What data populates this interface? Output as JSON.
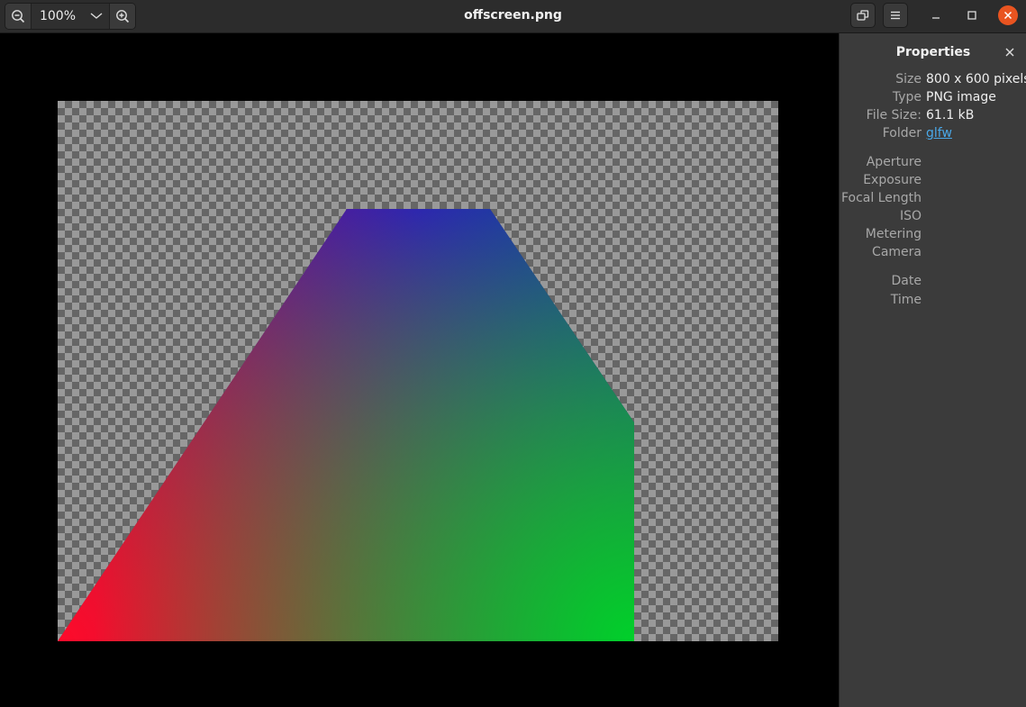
{
  "window": {
    "title": "offscreen.png"
  },
  "toolbar": {
    "zoom_out_icon": "zoom-out-icon",
    "zoom_level": "100%",
    "zoom_dropdown_icon": "chevron-down-icon",
    "zoom_in_icon": "zoom-in-icon",
    "fit_icon": "window-restore-icon",
    "menu_icon": "hamburger-menu-icon",
    "minimize_icon": "minimize-icon",
    "maximize_icon": "maximize-icon",
    "close_icon": "close-icon",
    "close_color": "#e95420"
  },
  "image": {
    "shape_colors": {
      "bottom_left": "#ff0a2a",
      "bottom_right": "#00c82d",
      "top": "#2a10c8",
      "top_right": "#0040c0"
    }
  },
  "properties": {
    "title": "Properties",
    "rows": [
      {
        "label": "Size",
        "value": "800 x 600 pixels"
      },
      {
        "label": "Type",
        "value": "PNG image"
      },
      {
        "label": "File Size:",
        "value": "61.1 kB"
      },
      {
        "label": "Folder",
        "value": "glfw"
      },
      {
        "label": "Aperture",
        "value": ""
      },
      {
        "label": "Exposure",
        "value": ""
      },
      {
        "label": "Focal Length",
        "value": ""
      },
      {
        "label": "ISO",
        "value": ""
      },
      {
        "label": "Metering",
        "value": ""
      },
      {
        "label": "Camera",
        "value": ""
      },
      {
        "label": "Date",
        "value": ""
      },
      {
        "label": "Time",
        "value": ""
      }
    ]
  }
}
